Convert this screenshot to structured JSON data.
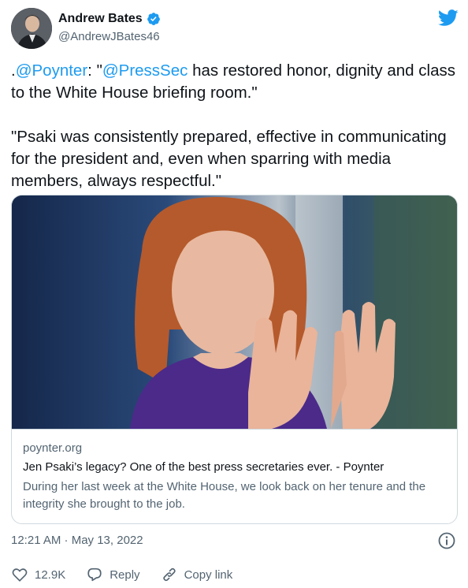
{
  "author": {
    "display_name": "Andrew Bates",
    "handle": "@AndrewJBates46",
    "verified_icon": "verified-badge-icon"
  },
  "brand_color": "#1d9bf0",
  "tweet": {
    "prefix": ".",
    "mention_1": "@Poynter",
    "text_1": ": \"",
    "mention_2": "@PressSec",
    "text_2": " has restored honor, dignity and class to the White House briefing room.\"\n\n\"Psaki was consistently prepared, effective in communicating for the president and, even when sparring with media members, always respectful.\""
  },
  "card": {
    "domain": "poynter.org",
    "title": "Jen Psaki’s legacy? One of the best press secretaries ever. - Poynter",
    "description": "During her last week at the White House, we look back on her tenure and the integrity she brought to the job."
  },
  "timestamp": "12:21 AM · May 13, 2022",
  "actions": {
    "likes": "12.9K",
    "reply": "Reply",
    "copy_link": "Copy link"
  }
}
